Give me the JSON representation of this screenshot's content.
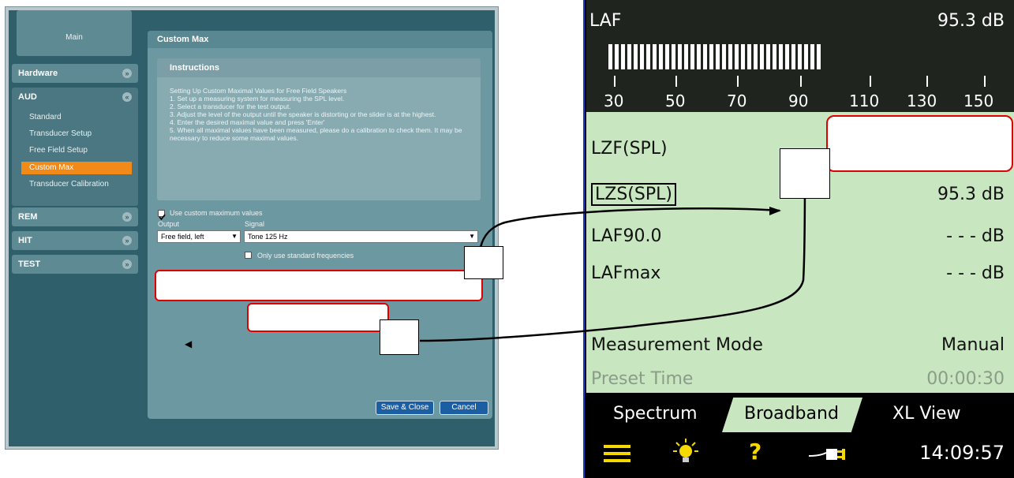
{
  "left_app": {
    "main_tab": "Main",
    "sidebar": {
      "hardware": "Hardware",
      "aud": "AUD",
      "aud_items": [
        "Standard",
        "Transducer Setup",
        "Free Field Setup",
        "Custom Max",
        "Transducer Calibration"
      ],
      "rem": "REM",
      "hit": "HIT",
      "test": "TEST"
    },
    "panel_title": "Custom Max",
    "instructions_title": "Instructions",
    "instructions_text": "Setting Up Custom Maximal Values for Free Field Speakers\n1. Set up a measuring system for measuring the SPL level.\n2. Select a transducer for the test output.\n3. Adjust the level of the output until the speaker is distorting or the slider is at the highest.\n4. Enter the desired maximal value and press 'Enter'\n5. When all maximal values have been measured, please do a calibration to check them. It may be necessary to reduce some maximal values.",
    "use_custom_label": "Use custom maximum values",
    "output_label": "Output",
    "signal_label": "Signal",
    "output_value": "Free field, left",
    "signal_value": "Tone 125 Hz",
    "only_standard_label": "Only use standard frequencies",
    "save_close": "Save & Close",
    "cancel": "Cancel"
  },
  "device": {
    "meter_label": "LAF",
    "meter_value": "95.3 dB",
    "scale_ticks": [
      "30",
      "50",
      "70",
      "90",
      "110",
      "130",
      "150"
    ],
    "rows": [
      {
        "label": "LZF(SPL)",
        "value": ""
      },
      {
        "label": "LZS(SPL)",
        "value": "95.3 dB"
      },
      {
        "label": "LAF90.0",
        "value": "- - - dB"
      },
      {
        "label": "LAFmax",
        "value": "- - - dB"
      }
    ],
    "measurement_mode_label": "Measurement Mode",
    "measurement_mode_value": "Manual",
    "preset_time_label": "Preset Time",
    "preset_time_value": "00:00:30",
    "tabs": [
      "Spectrum",
      "Broadband",
      "XL View"
    ],
    "time": "14:09:57",
    "colors": {
      "screen_bg": "#c8e6bf",
      "accent": "#f5d800",
      "meter_bg": "#1f241f"
    }
  }
}
